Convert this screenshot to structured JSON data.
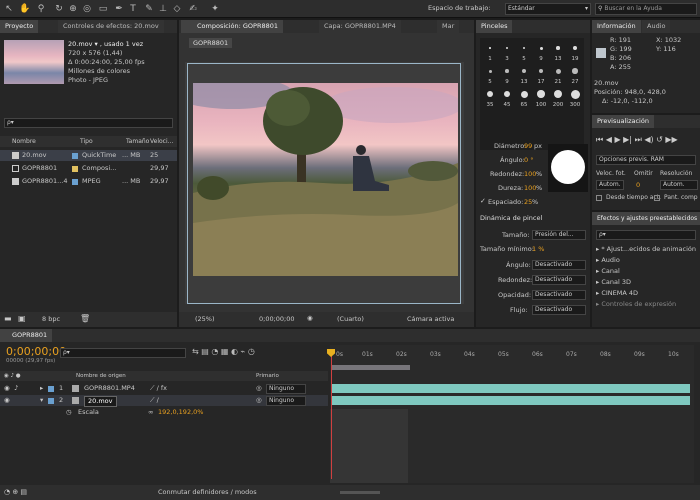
{
  "toolbar": {
    "workspace_label": "Espacio de trabajo:",
    "workspace_value": "Estándar",
    "search_placeholder": "Buscar en la Ayuda"
  },
  "project": {
    "tab": "Proyecto",
    "effects_tab": "Controles de efectos: 20.mov",
    "file_name": "20.mov ▾ , usado 1 vez",
    "line1": "720 x 576 (1,44)",
    "line2": "Δ 0:00:24:00, 25,00 fps",
    "line3": "Millones de colores",
    "line4": "Photo - JPEG",
    "search_value": "ρ▾",
    "columns": [
      "Nombre",
      "Tipo",
      "Tamaño",
      "Veloci..."
    ],
    "items": [
      {
        "name": "20.mov",
        "type": "QuickTime",
        "size": "... MB",
        "speed": "25",
        "color": "#6aa0d0"
      },
      {
        "name": "GOPR8801",
        "type": "Composi...",
        "size": "",
        "speed": "29,97",
        "color": "#e0c060"
      },
      {
        "name": "GOPR8801...4",
        "type": "MPEG",
        "size": "... MB",
        "speed": "29,97",
        "color": "#6aa0d0"
      }
    ],
    "bpc": "8 bpc"
  },
  "comp": {
    "tab": "Composición: GOPR8801",
    "layer_tab": "Capa: GOPR8801.MP4",
    "more_tab": "Mar",
    "breadcrumb": "GOPR8801",
    "zoom": "(25%)",
    "timecode": "0;00;00;00",
    "quality": "(Cuarto)",
    "camera": "Cámara activa"
  },
  "brushes": {
    "tab": "Pinceles",
    "sizes": [
      "1",
      "3",
      "5",
      "9",
      "13",
      "19",
      "5",
      "9",
      "13",
      "17",
      "21",
      "27",
      "35",
      "45",
      "65",
      "100",
      "200",
      "300"
    ],
    "diameter_label": "Diámetro:",
    "diameter_value": "99",
    "diameter_unit": "px",
    "angle_label": "Ángulo:",
    "angle_value": "0 °",
    "roundness_label": "Redondez:",
    "roundness_value": "100",
    "hardness_label": "Dureza:",
    "hardness_value": "100",
    "spacing_label": "Espaciado:",
    "spacing_value": "25",
    "percent": "%",
    "dynamics_title": "Dinámica de pincel",
    "dynamics": [
      {
        "label": "Tamaño:",
        "value": "Presión del..."
      },
      {
        "label": "Tamaño mínimo:",
        "value": "1 %"
      },
      {
        "label": "Ángulo:",
        "value": "Desactivado"
      },
      {
        "label": "Redondez:",
        "value": "Desactivado"
      },
      {
        "label": "Opacidad:",
        "value": "Desactivado"
      },
      {
        "label": "Flujo:",
        "value": "Desactivado"
      }
    ]
  },
  "info": {
    "tab": "Información",
    "audio_tab": "Audio",
    "r": "R: 191",
    "g": "G: 199",
    "b": "B: 206",
    "a": "A: 255",
    "x": "X: 1032",
    "y": "Y: 116",
    "file": "20.mov",
    "position": "Posición: 948,0, 428,0",
    "delta": "Δ: -12,0, -112,0"
  },
  "preview": {
    "tab": "Previsualización",
    "options_label": "Opciones previs. RAM",
    "fps_label": "Veloc. fot.",
    "skip_label": "Omitir",
    "resolution_label": "Resolución",
    "fps_value": "Autom.",
    "skip_value": "0",
    "resolution_value": "Autom.",
    "current_time_label": "Desde tiempo act.",
    "fullscreen_label": "Pant. comp"
  },
  "effects": {
    "tab": "Efectos y ajustes preestablecidos",
    "search_value": "ρ▾",
    "items": [
      "* Ajust...ecidos de animación",
      "Audio",
      "Canal",
      "Canal 3D",
      "CINEMA 4D",
      "Controles de expresión"
    ]
  },
  "timeline": {
    "tab": "GOPR8801",
    "timecode": "0;00;00;00",
    "frame_info": "00000 (29,97 fps)",
    "search_value": "ρ▾",
    "col_name": "Nombre de origen",
    "col_parent": "Primario",
    "ticks": [
      "0s",
      "01s",
      "02s",
      "03s",
      "04s",
      "05s",
      "06s",
      "07s",
      "08s",
      "09s",
      "10s"
    ],
    "layers": [
      {
        "num": "1",
        "name": "GOPR8801.MP4",
        "parent": "Ninguno"
      },
      {
        "num": "2",
        "name": "20.mov",
        "parent": "Ninguno"
      }
    ],
    "scale_label": "Escala",
    "scale_value": "192,0,192,0%",
    "toggle_label": "Conmutar definidores / modos"
  }
}
